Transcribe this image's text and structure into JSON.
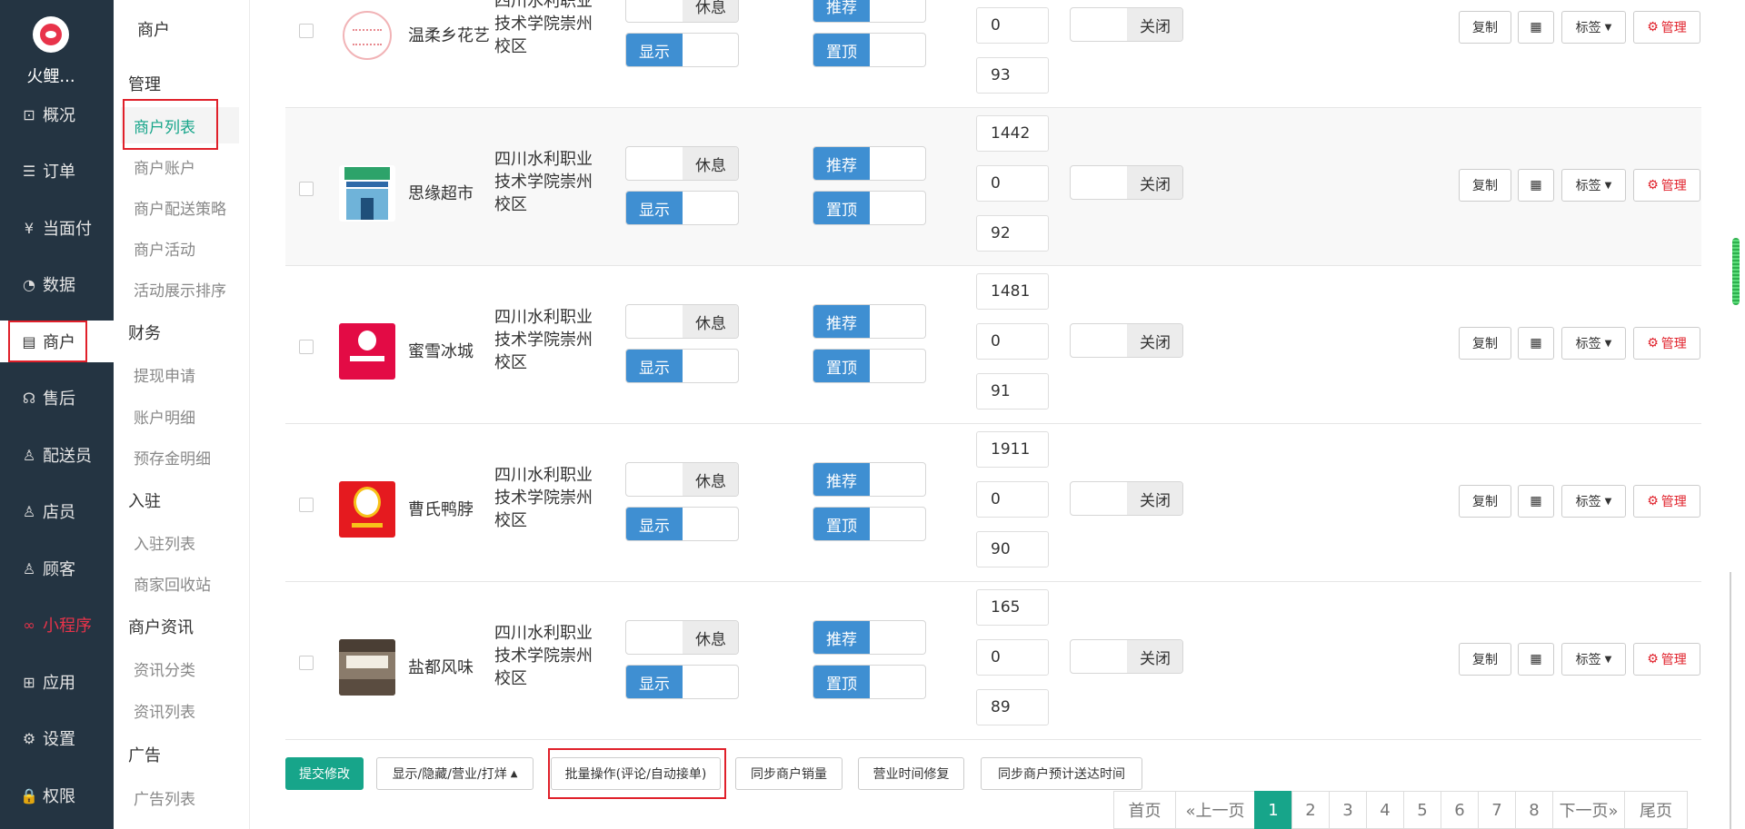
{
  "brand": {
    "name": "火鲤..."
  },
  "nav": [
    {
      "id": "overview",
      "label": "概况",
      "icon": "dashboard-icon"
    },
    {
      "id": "orders",
      "label": "订单",
      "icon": "list-icon"
    },
    {
      "id": "facepay",
      "label": "当面付",
      "icon": "yen-icon"
    },
    {
      "id": "data",
      "label": "数据",
      "icon": "chart-icon"
    },
    {
      "id": "merchants",
      "label": "商户",
      "icon": "store-icon",
      "active": true
    },
    {
      "id": "aftersale",
      "label": "售后",
      "icon": "headset-icon"
    },
    {
      "id": "couriers",
      "label": "配送员",
      "icon": "user-icon"
    },
    {
      "id": "staff",
      "label": "店员",
      "icon": "staff-icon"
    },
    {
      "id": "customers",
      "label": "顾客",
      "icon": "customer-icon"
    },
    {
      "id": "miniapp",
      "label": "小程序",
      "icon": "miniapp-icon",
      "highlight": "#e8334a"
    },
    {
      "id": "apps",
      "label": "应用",
      "icon": "apps-icon"
    },
    {
      "id": "settings",
      "label": "设置",
      "icon": "gear-icon"
    },
    {
      "id": "permissions",
      "label": "权限",
      "icon": "lock-icon"
    }
  ],
  "subnav": {
    "title": "商户",
    "groups": [
      {
        "title": "管理",
        "items": [
          "商户列表",
          "商户账户",
          "商户配送策略",
          "商户活动",
          "活动展示排序"
        ],
        "active": "商户列表"
      },
      {
        "title": "财务",
        "items": [
          "提现申请",
          "账户明细",
          "预存金明细"
        ]
      },
      {
        "title": "入驻",
        "items": [
          "入驻列表",
          "商家回收站"
        ]
      },
      {
        "title": "商户资讯",
        "items": [
          "资讯分类",
          "资讯列表"
        ]
      },
      {
        "title": "广告",
        "items": [
          "广告列表"
        ]
      }
    ]
  },
  "toggles": {
    "rest": "休息",
    "recommend": "推荐",
    "show": "显示",
    "pin": "置顶",
    "close": "关闭"
  },
  "actions": {
    "copy": "复制",
    "tag": "标签",
    "manage": "管理"
  },
  "rows": [
    {
      "name": "温柔乡花艺",
      "address": "四川水利职业技术学院崇州校区",
      "thumb": "t-flower",
      "num1": "",
      "num2": "0",
      "num3": "93"
    },
    {
      "name": "思缘超市",
      "address": "四川水利职业技术学院崇州校区",
      "thumb": "t-super",
      "num1": "1442",
      "num2": "0",
      "num3": "92"
    },
    {
      "name": "蜜雪冰城",
      "address": "四川水利职业技术学院崇州校区",
      "thumb": "t-ice",
      "num1": "1481",
      "num2": "0",
      "num3": "91"
    },
    {
      "name": "曹氏鸭脖",
      "address": "四川水利职业技术学院崇州校区",
      "thumb": "t-duck",
      "num1": "1911",
      "num2": "0",
      "num3": "90"
    },
    {
      "name": "盐都风味",
      "address": "四川水利职业技术学院崇州校区",
      "thumb": "t-salt",
      "num1": "165",
      "num2": "0",
      "num3": "89"
    }
  ],
  "bottom": {
    "submit": "提交修改",
    "show_hide": "显示/隐藏/营业/打烊",
    "batch": "批量操作(评论/自动接单)",
    "sync_sales": "同步商户销量",
    "fix_hours": "营业时间修复",
    "sync_eta": "同步商户预计送达时间"
  },
  "pager": {
    "first": "首页",
    "prev": "«上一页",
    "pages": [
      "1",
      "2",
      "3",
      "4",
      "5",
      "6",
      "7",
      "8"
    ],
    "current": "1",
    "next": "下一页»",
    "last": "尾页"
  },
  "colors": {
    "accent": "#17a58a",
    "toggle_blue": "#3f8fd2",
    "nav_bg": "#243442",
    "highlight_red": "#e0202a"
  }
}
